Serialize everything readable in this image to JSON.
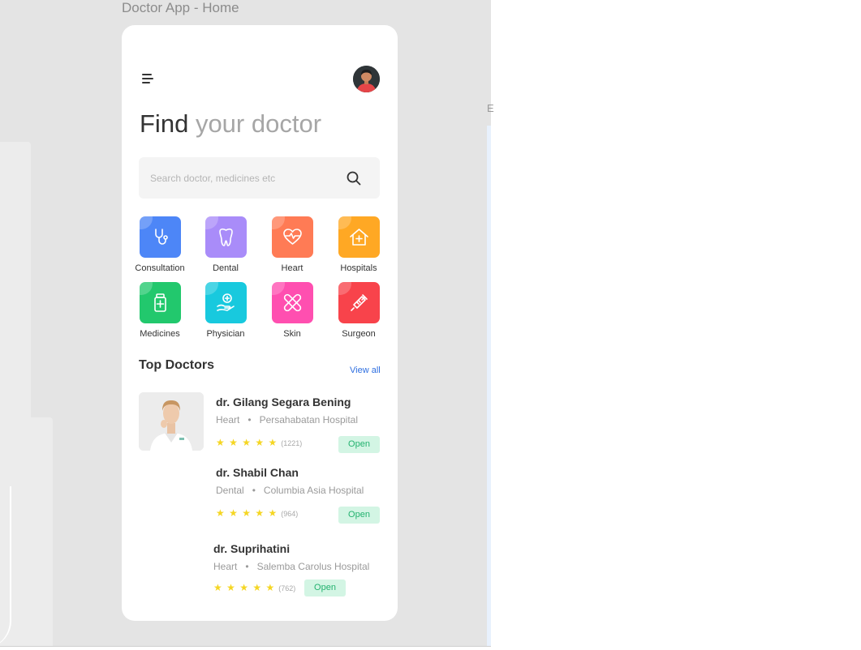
{
  "canvas": {
    "title": "Doctor App - Home",
    "glyph": "E"
  },
  "header": {
    "heading_dark": "Find",
    "heading_light": "your doctor"
  },
  "search": {
    "placeholder": "Search doctor, medicines etc"
  },
  "categories": [
    {
      "label": "Consultation",
      "color": "#4d86f7",
      "icon": "stethoscope-icon"
    },
    {
      "label": "Dental",
      "color": "#a98cf9",
      "icon": "tooth-icon"
    },
    {
      "label": "Heart",
      "color": "#ff7b55",
      "icon": "heart-pulse-icon"
    },
    {
      "label": "Hospitals",
      "color": "#ffa824",
      "icon": "hospital-icon"
    },
    {
      "label": "Medicines",
      "color": "#22c86d",
      "icon": "medicine-bottle-icon"
    },
    {
      "label": "Physician",
      "color": "#18c9de",
      "icon": "hand-care-icon"
    },
    {
      "label": "Skin",
      "color": "#ff4fb0",
      "icon": "bandage-icon"
    },
    {
      "label": "Surgeon",
      "color": "#f8434b",
      "icon": "syringe-icon"
    }
  ],
  "top_doctors": {
    "title": "Top Doctors",
    "view_all": "View all",
    "doctors": [
      {
        "name": "dr. Gilang Segara Bening",
        "specialty": "Heart",
        "hospital": "Persahabatan Hospital",
        "rating": 5,
        "reviews": "(1221)",
        "status": "Open"
      },
      {
        "name": "dr. Shabil Chan",
        "specialty": "Dental",
        "hospital": "Columbia Asia Hospital",
        "rating": 5,
        "reviews": "(964)",
        "status": "Open"
      },
      {
        "name": "dr. Suprihatini",
        "specialty": "Heart",
        "hospital": "Salemba Carolus Hospital",
        "rating": 5,
        "reviews": "(762)",
        "status": "Open"
      }
    ]
  },
  "colors": {
    "accent": "#2f6fe0",
    "star": "#f5d623",
    "open_bg": "#d3f5e4",
    "open_text": "#23b26f"
  }
}
